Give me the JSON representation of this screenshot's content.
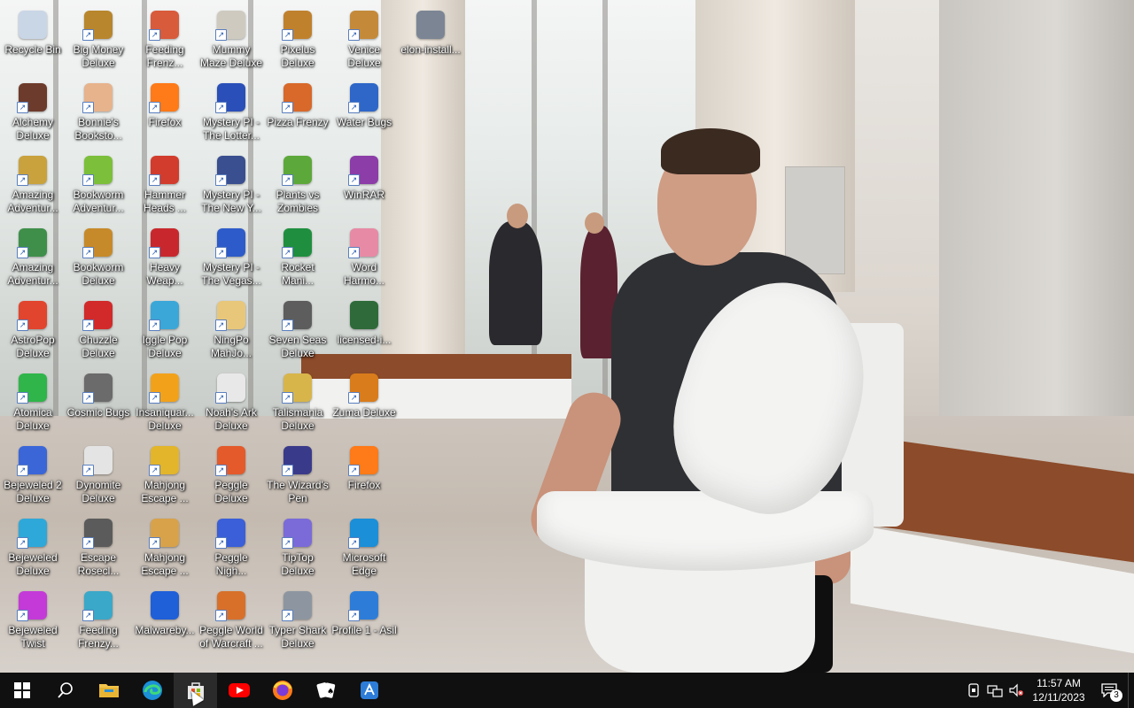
{
  "desktop": {
    "icons": [
      {
        "label": "Recycle Bin",
        "icon": "recycle-bin-icon",
        "color": "#c9d6e6",
        "shortcut": false
      },
      {
        "label": "Big Money Deluxe",
        "icon": "money-bag-icon",
        "color": "#b8862d",
        "shortcut": true
      },
      {
        "label": "Feeding Frenz...",
        "icon": "fish-icon",
        "color": "#d85b3b",
        "shortcut": true
      },
      {
        "label": "Mummy Maze Deluxe",
        "icon": "mummy-icon",
        "color": "#cfcac0",
        "shortcut": true
      },
      {
        "label": "Pixelus Deluxe",
        "icon": "pixelus-icon",
        "color": "#c0812d",
        "shortcut": true
      },
      {
        "label": "Venice Deluxe",
        "icon": "gondola-icon",
        "color": "#c48a3a",
        "shortcut": true
      },
      {
        "label": "elon-install...",
        "icon": "installer-icon",
        "color": "#7b8594",
        "shortcut": false
      },
      {
        "label": "Alchemy Deluxe",
        "icon": "wizard-icon",
        "color": "#6d3b2b",
        "shortcut": true
      },
      {
        "label": "Bonnie's Booksto...",
        "icon": "bonnie-icon",
        "color": "#e7b38c",
        "shortcut": true
      },
      {
        "label": "Firefox",
        "icon": "firefox-icon",
        "color": "#ff7a18",
        "shortcut": true
      },
      {
        "label": "Mystery PI - The Lotter...",
        "icon": "mystery-pi-icon",
        "color": "#2b4fb8",
        "shortcut": true
      },
      {
        "label": "Pizza Frenzy",
        "icon": "pizza-icon",
        "color": "#d8692a",
        "shortcut": true
      },
      {
        "label": "Water Bugs",
        "icon": "water-bugs-icon",
        "color": "#2e67c8",
        "shortcut": true
      },
      {
        "label": "Amazing Adventur...",
        "icon": "compass-icon",
        "color": "#c9a23d",
        "shortcut": true
      },
      {
        "label": "Bookworm Adventur...",
        "icon": "bookworm-icon",
        "color": "#7cbf3a",
        "shortcut": true
      },
      {
        "label": "Hammer Heads ...",
        "icon": "gnome-icon",
        "color": "#d23c2c",
        "shortcut": true
      },
      {
        "label": "Mystery PI - The New Y...",
        "icon": "mystery-pi-icon",
        "color": "#3a4f8f",
        "shortcut": true
      },
      {
        "label": "Plants vs Zombies",
        "icon": "plant-icon",
        "color": "#5da83a",
        "shortcut": true
      },
      {
        "label": "WinRAR",
        "icon": "winrar-icon",
        "color": "#8c3da8",
        "shortcut": true
      },
      {
        "label": "Amazing Adventur...",
        "icon": "compass-icon",
        "color": "#3f8f4a",
        "shortcut": true
      },
      {
        "label": "Bookworm Deluxe",
        "icon": "bookworm-icon",
        "color": "#c78a2a",
        "shortcut": true
      },
      {
        "label": "Heavy Weap...",
        "icon": "heavy-weapon-icon",
        "color": "#c8282d",
        "shortcut": true
      },
      {
        "label": "Mystery PI - The Vegas...",
        "icon": "mystery-pi-icon",
        "color": "#2d5bc9",
        "shortcut": true
      },
      {
        "label": "Rocket Mani...",
        "icon": "rocket-icon",
        "color": "#1f8f3f",
        "shortcut": true
      },
      {
        "label": "Word Harmo...",
        "icon": "flower-icon",
        "color": "#e78aa6",
        "shortcut": true
      },
      {
        "label": "AstroPop Deluxe",
        "icon": "astropop-icon",
        "color": "#e2452d",
        "shortcut": true
      },
      {
        "label": "Chuzzle Deluxe",
        "icon": "chuzzle-icon",
        "color": "#d22a2a",
        "shortcut": true
      },
      {
        "label": "Iggle Pop Deluxe",
        "icon": "iggle-pop-icon",
        "color": "#3ba7d8",
        "shortcut": true
      },
      {
        "label": "NingPo MahJo...",
        "icon": "mahjong-tile-icon",
        "color": "#e8c77a",
        "shortcut": true
      },
      {
        "label": "Seven Seas Deluxe",
        "icon": "skull-icon",
        "color": "#5d5d5d",
        "shortcut": true
      },
      {
        "label": "licensed-i...",
        "icon": "image-file-icon",
        "color": "#2f6b3a",
        "shortcut": false
      },
      {
        "label": "Atomica Deluxe",
        "icon": "atom-icon",
        "color": "#2fb54a",
        "shortcut": true
      },
      {
        "label": "Cosmic Bugs",
        "icon": "bug-icon",
        "color": "#6b6b6b",
        "shortcut": true
      },
      {
        "label": "Insaniquar... Deluxe",
        "icon": "goldfish-icon",
        "color": "#f2a21a",
        "shortcut": true
      },
      {
        "label": "Noah's Ark Deluxe",
        "icon": "dove-icon",
        "color": "#e8e8e8",
        "shortcut": true
      },
      {
        "label": "Talismania Deluxe",
        "icon": "talisman-icon",
        "color": "#d8b54a",
        "shortcut": true
      },
      {
        "label": "Zuma Deluxe",
        "icon": "zuma-icon",
        "color": "#d97c1c",
        "shortcut": true
      },
      {
        "label": "Bejeweled 2 Deluxe",
        "icon": "gem-icon",
        "color": "#3a66d8",
        "shortcut": true
      },
      {
        "label": "Dynomite Deluxe",
        "icon": "egg-icon",
        "color": "#e4e4e4",
        "shortcut": true
      },
      {
        "label": "Mahjong Escape ...",
        "icon": "mahjong-tile-icon",
        "color": "#e3b52a",
        "shortcut": true
      },
      {
        "label": "Peggle Deluxe",
        "icon": "peggle-icon",
        "color": "#e45a2a",
        "shortcut": true
      },
      {
        "label": "The Wizard's Pen",
        "icon": "wizard-hat-icon",
        "color": "#3a3a8a",
        "shortcut": true
      },
      {
        "label": "Firefox",
        "icon": "firefox-icon",
        "color": "#ff7a18",
        "shortcut": true
      },
      {
        "label": "Bejeweled Deluxe",
        "icon": "gem-icon",
        "color": "#2ea8d8",
        "shortcut": true
      },
      {
        "label": "Escape Rosecl...",
        "icon": "moon-icon",
        "color": "#5b5b5b",
        "shortcut": true
      },
      {
        "label": "Mahjong Escape ...",
        "icon": "gate-icon",
        "color": "#d8a24a",
        "shortcut": true
      },
      {
        "label": "Peggle Nigh...",
        "icon": "peggle-icon",
        "color": "#3a5fd8",
        "shortcut": true
      },
      {
        "label": "TipTop Deluxe",
        "icon": "tiptop-icon",
        "color": "#7a6bd8",
        "shortcut": true
      },
      {
        "label": "Microsoft Edge",
        "icon": "edge-icon",
        "color": "#1b8fd8",
        "shortcut": true
      },
      {
        "label": "Bejeweled Twist",
        "icon": "gem-icon",
        "color": "#c43ad8",
        "shortcut": true
      },
      {
        "label": "Feeding Frenzy...",
        "icon": "fish-icon",
        "color": "#3aa8c8",
        "shortcut": true
      },
      {
        "label": "Malwareby...",
        "icon": "malwarebytes-icon",
        "color": "#1f5fd8",
        "shortcut": false
      },
      {
        "label": "Peggle World of Warcraft ...",
        "icon": "peggle-icon",
        "color": "#d8702a",
        "shortcut": true
      },
      {
        "label": "Typer Shark Deluxe",
        "icon": "shark-icon",
        "color": "#8d96a0",
        "shortcut": true
      },
      {
        "label": "Profile 1 - Asil",
        "icon": "app-store-icon",
        "color": "#2d7dd8",
        "shortcut": true
      }
    ]
  },
  "taskbar": {
    "pinned": [
      {
        "name": "start-button",
        "icon": "windows-logo-icon",
        "glyph": ""
      },
      {
        "name": "search-button",
        "icon": "search-icon",
        "glyph": "⌕"
      },
      {
        "name": "file-explorer-button",
        "icon": "folder-icon",
        "glyph": ""
      },
      {
        "name": "edge-button",
        "icon": "edge-icon",
        "glyph": ""
      },
      {
        "name": "store-button",
        "icon": "store-icon",
        "glyph": ""
      },
      {
        "name": "youtube-button",
        "icon": "youtube-icon",
        "glyph": "▶"
      },
      {
        "name": "firefox-button",
        "icon": "firefox-icon",
        "glyph": ""
      },
      {
        "name": "solitaire-button",
        "icon": "cards-icon",
        "glyph": "♠"
      },
      {
        "name": "app-store-button",
        "icon": "app-store-icon",
        "glyph": "A"
      }
    ],
    "tray": {
      "clock_time": "11:57 AM",
      "clock_date": "12/11/2023",
      "notification_count": "3"
    }
  },
  "colors": {
    "taskbar": "#101010",
    "taskbar_active": "#2b2b2b"
  }
}
